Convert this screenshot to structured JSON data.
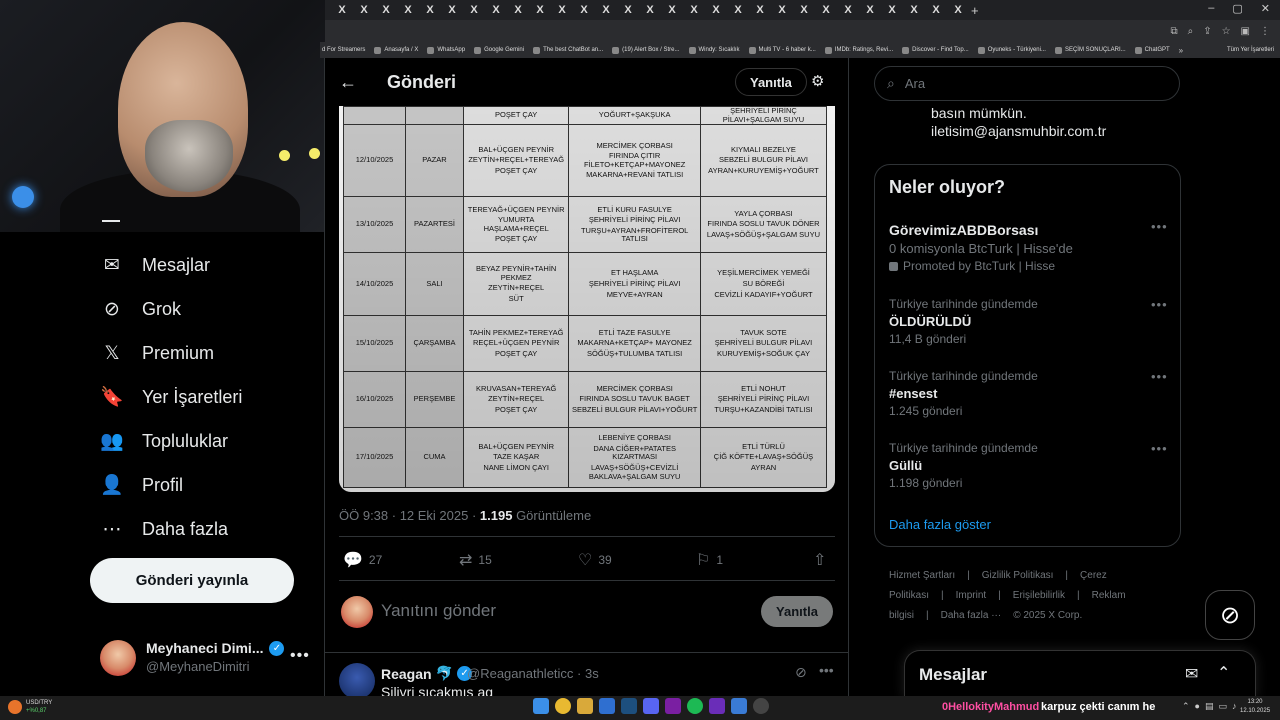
{
  "browser": {
    "tab_close_glyph": "X",
    "tab_count": 29,
    "bookmarks": [
      "d For Streamers",
      "Anasayfa / X",
      "WhatsApp",
      "Google Gemini",
      "The best ChatBot an...",
      "(19) Alert Box / Stre...",
      "Windy: Sıcaklık",
      "Multi TV - 6 haber k...",
      "IMDb: Ratings, Revi...",
      "Discover - Find Top...",
      "Oyuneks - Türkiyeni...",
      "SEÇİM SONUÇLARI...",
      "ChatGPT"
    ],
    "bookmarks_all": "Tüm Yer İşaretleri"
  },
  "nav": {
    "items": [
      {
        "label": "Mesajlar",
        "icon": "envelope-icon",
        "glyph": "✉"
      },
      {
        "label": "Grok",
        "icon": "grok-icon",
        "glyph": "⊘"
      },
      {
        "label": "Premium",
        "icon": "x-logo-icon",
        "glyph": "𝕏"
      },
      {
        "label": "Yer İşaretleri",
        "icon": "bookmark-icon",
        "glyph": "🔖"
      },
      {
        "label": "Topluluklar",
        "icon": "communities-icon",
        "glyph": "👥"
      },
      {
        "label": "Profil",
        "icon": "person-icon",
        "glyph": "👤"
      },
      {
        "label": "Daha fazla",
        "icon": "more-circle-icon",
        "glyph": "⋯"
      }
    ],
    "post_button": "Gönderi yayınla"
  },
  "account": {
    "name": "Meyhaneci Dimi...",
    "handle": "@MeyhaneDimitri"
  },
  "post": {
    "header_title": "Gönderi",
    "reply_pill": "Yanıtla",
    "time": "ÖÖ 9:38 · 12 Eki 2025 · ",
    "views": "1.195",
    "views_label": " Görüntüleme",
    "actions": {
      "replies": "27",
      "reposts": "15",
      "likes": "39",
      "bookmarks": "1"
    },
    "reply_placeholder": "Yanıtını gönder",
    "reply_button": "Yanıtla"
  },
  "menu_table": {
    "top_row": [
      "POŞET ÇAY",
      "YOĞURT+ŞAKŞUKA",
      "ŞEHRİYELİ PİRİNÇ PİLAVI+ŞALGAM SUYU"
    ],
    "rows": [
      {
        "date": "12/10/2025",
        "day": "PAZAR",
        "breakfast": [
          "BAL+ÜÇGEN PEYNİR",
          "ZEYTİN+REÇEL+TEREYAĞ",
          "POŞET ÇAY"
        ],
        "lunch": [
          "MERCİMEK ÇORBASI",
          "FIRINDA ÇITIR FİLETO+KETÇAP+MAYONEZ",
          "MAKARNA+REVANİ TATLISI"
        ],
        "dinner": [
          "KIYMALI BEZELYE",
          "SEBZELİ BULGUR PİLAVI",
          "AYRAN+KURUYEMİŞ+YOĞURT"
        ]
      },
      {
        "date": "13/10/2025",
        "day": "PAZARTESİ",
        "breakfast": [
          "TEREYAĞ+ÜÇGEN PEYNİR",
          "YUMURTA HAŞLAMA+REÇEL",
          "POŞET ÇAY"
        ],
        "lunch": [
          "ETLİ KURU FASULYE",
          "ŞEHRİYELİ PİRİNÇ PİLAVI",
          "TURŞU+AYRAN+FROFİTEROL TATLISI"
        ],
        "dinner": [
          "YAYLA ÇORBASI",
          "FIRINDA SOSLU TAVUK DÖNER",
          "LAVAŞ+SÖĞÜŞ+ŞALGAM SUYU"
        ]
      },
      {
        "date": "14/10/2025",
        "day": "SALI",
        "breakfast": [
          "BEYAZ PEYNİR+TAHİN PEKMEZ",
          "ZEYTİN+REÇEL",
          "SÜT"
        ],
        "lunch": [
          "ET HAŞLAMA",
          "ŞEHRİYELİ PİRİNÇ PİLAVI",
          "MEYVE+AYRAN"
        ],
        "dinner": [
          "YEŞİLMERCİMEK YEMEĞİ",
          "SU BÖREĞİ",
          "CEVİZLİ KADAYIF+YOĞURT"
        ]
      },
      {
        "date": "15/10/2025",
        "day": "ÇARŞAMBA",
        "breakfast": [
          "TAHİN PEKMEZ+TEREYAĞ",
          "REÇEL+ÜÇGEN PEYNİR",
          "POŞET ÇAY"
        ],
        "lunch": [
          "ETLİ TAZE FASULYE",
          "MAKARNA+KETÇAP+ MAYONEZ",
          "SÖĞÜŞ+TULUMBA TATLISI"
        ],
        "dinner": [
          "TAVUK SOTE",
          "ŞEHRİYELİ BULGUR PİLAVI",
          "KURUYEMİŞ+SOĞUK ÇAY"
        ]
      },
      {
        "date": "16/10/2025",
        "day": "PERŞEMBE",
        "breakfast": [
          "KRUVASAN+TEREYAĞ",
          "ZEYTİN+REÇEL",
          "POŞET ÇAY"
        ],
        "lunch": [
          "MERCİMEK ÇORBASI",
          "FIRINDA SOSLU TAVUK BAGET",
          "SEBZELİ BULGUR PİLAVI+YOĞURT"
        ],
        "dinner": [
          "ETLİ NOHUT",
          "ŞEHRİYELİ PİRİNÇ PİLAVI",
          "TURŞU+KAZANDİBİ TATLISI"
        ]
      },
      {
        "date": "17/10/2025",
        "day": "CUMA",
        "breakfast": [
          "BAL+ÜÇGEN PEYNİR",
          "TAZE KAŞAR",
          "NANE LİMON ÇAYI"
        ],
        "lunch": [
          "LEBENİYE ÇORBASI",
          "DANA CİĞER+PATATES KIZARTMASI",
          "LAVAŞ+SÖĞÜŞ+CEVİZLİ BAKLAVA+ŞALGAM SUYU"
        ],
        "dinner": [
          "ETLİ TÜRLÜ",
          "ÇİĞ KÖFTE+LAVAŞ+SÖĞÜŞ",
          "AYRAN"
        ]
      }
    ]
  },
  "reply_post": {
    "name": "Reagan",
    "emoji": "🐬",
    "handle": "@Reaganathleticc · 3s",
    "text": "Silivri sıcakmış ag"
  },
  "right": {
    "search_placeholder": "Ara",
    "bio_line1": "basın mümkün.",
    "bio_line2": "iletisim@ajansmuhbir.com.tr",
    "trends_title": "Neler oluyor?",
    "promo": {
      "name": "GörevimizABDBorsası",
      "desc": "0 komisyonla BtcTurk | Hisse'de",
      "by": "Promoted by BtcTurk | Hisse"
    },
    "trends": [
      {
        "meta": "Türkiye tarihinde gündemde",
        "name": "ÖLDÜRÜLDÜ",
        "count": "11,4 B gönderi"
      },
      {
        "meta": "Türkiye tarihinde gündemde",
        "name": "#ensest",
        "count": "1.245 gönderi"
      },
      {
        "meta": "Türkiye tarihinde gündemde",
        "name": "Güllü",
        "count": "1.198 gönderi"
      }
    ],
    "show_more": "Daha fazla göster",
    "footer": [
      "Hizmet Şartları",
      "|",
      "Gizlilik Politikası",
      "|",
      "Çerez Politikası",
      "|",
      "Imprint",
      "|",
      "Erişilebilirlik",
      "|",
      "Reklam bilgisi",
      "|",
      "Daha fazla ···",
      "© 2025 X Corp."
    ],
    "messages_drawer": "Mesajlar"
  },
  "taskbar": {
    "ticker_pair": "USD/TRY",
    "ticker_change": "+%0,87",
    "chat_user": "0HellokityMahmud",
    "chat_message": "karpuz çekti canım he",
    "clock_time": "13:20",
    "clock_date": "12.10.2025"
  }
}
